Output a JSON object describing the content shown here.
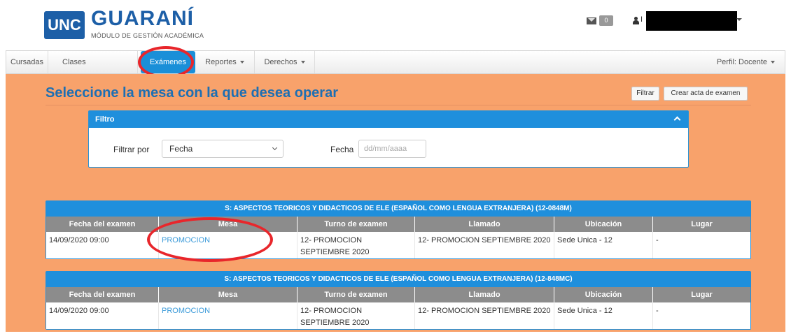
{
  "header": {
    "logo_text": "UNC",
    "brand_name": "GUARANÍ",
    "brand_subtitle": "MÓDULO DE GESTIÓN ACADÉMICA",
    "mail_count": "0",
    "user_name": "I"
  },
  "navbar": {
    "items": [
      {
        "label": "Cursadas"
      },
      {
        "label": "Clases"
      },
      {
        "label": "Exámenes"
      },
      {
        "label": "Reportes"
      },
      {
        "label": "Derechos"
      }
    ],
    "perfil": "Perfil: Docente"
  },
  "main": {
    "title": "Seleccione la mesa con la que desea operar",
    "filter_button": "Filtrar",
    "create_button": "Crear acta de examen"
  },
  "filter": {
    "heading": "Filtro",
    "filter_by_label": "Filtrar por",
    "filter_by_value": "Fecha",
    "date_label": "Fecha",
    "date_placeholder": "dd/mm/aaaa"
  },
  "columns": [
    "Fecha del examen",
    "Mesa",
    "Turno de examen",
    "Llamado",
    "Ubicación",
    "Lugar"
  ],
  "tables": [
    {
      "title": "S: ASPECTOS TEORICOS Y DIDACTICOS DE ELE (ESPAÑOL COMO LENGUA EXTRANJERA) (12-0848M)",
      "row": {
        "fecha": "14/09/2020 09:00",
        "mesa": "PROMOCION",
        "turno": "12- PROMOCION SEPTIEMBRE 2020",
        "llamado": "12- PROMOCION SEPTIEMBRE 2020",
        "ubicacion": "Sede Unica - 12",
        "lugar": "-"
      }
    },
    {
      "title": "S: ASPECTOS TEORICOS Y DIDACTICOS DE ELE (ESPAÑOL COMO LENGUA EXTRANJERA) (12-848MC)",
      "row": {
        "fecha": "14/09/2020 09:00",
        "mesa": "PROMOCION",
        "turno": "12- PROMOCION SEPTIEMBRE 2020",
        "llamado": "12- PROMOCION SEPTIEMBRE 2020",
        "ubicacion": "Sede Unica - 12",
        "lugar": "-"
      }
    }
  ],
  "colors": {
    "brand_blue": "#1d5fa7",
    "accent_blue": "#1f8fdc",
    "content_bg": "#f8a26b",
    "annotation_red": "#e8262b"
  }
}
